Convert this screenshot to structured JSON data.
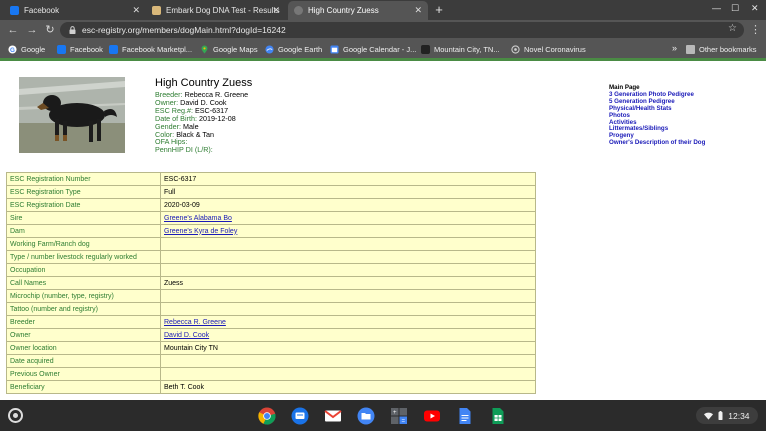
{
  "browser": {
    "tabs": [
      {
        "title": "Facebook",
        "color": "#1877f2"
      },
      {
        "title": "Embark Dog DNA Test - Results",
        "color": "#d9b87a"
      },
      {
        "title": "High Country Zuess",
        "color": "#777777"
      }
    ],
    "url": "esc-registry.org/members/dogMain.html?dogId=16242"
  },
  "bookmarks": {
    "items": [
      {
        "label": "Google",
        "icon": "google-icon",
        "color": "#ffffff"
      },
      {
        "label": "Facebook",
        "icon": "facebook-icon",
        "color": "#1877f2"
      },
      {
        "label": "Facebook Marketpl...",
        "icon": "facebook-icon",
        "color": "#1877f2"
      },
      {
        "label": "Google Maps",
        "icon": "google-maps-icon",
        "color": "#34a853"
      },
      {
        "label": "Google Earth",
        "icon": "google-earth-icon",
        "color": "#4285f4"
      },
      {
        "label": "Google Calendar - J...",
        "icon": "calendar-icon",
        "color": "#4285f4"
      },
      {
        "label": "Mountain City, TN...",
        "icon": "site-icon",
        "color": "#222222"
      },
      {
        "label": "Novel Coronavirus",
        "icon": "site-icon",
        "color": "#cccccc"
      }
    ],
    "other": "Other bookmarks"
  },
  "dog": {
    "name": "High Country Zuess",
    "fields": [
      {
        "label": "Breeder:",
        "value": "Rebecca R. Greene"
      },
      {
        "label": "Owner:",
        "value": "David D. Cook"
      },
      {
        "label": "ESC Reg.#:",
        "value": "ESC-6317"
      },
      {
        "label": "Date of Birth:",
        "value": "2019-12-08"
      },
      {
        "label": "Gender:",
        "value": "Male"
      },
      {
        "label": "Color:",
        "value": "Black & Tan"
      },
      {
        "label": "OFA Hips:",
        "value": ""
      },
      {
        "label": "PennHIP DI (L/R):",
        "value": ""
      }
    ]
  },
  "sidenav": {
    "heading": "Main Page",
    "links": [
      "3 Generation Photo Pedigree",
      "5 Generation Pedigree",
      "Physical/Health Stats",
      "Photos",
      "Activities",
      "Littermates/Siblings",
      "Progeny",
      "Owner's Description of their Dog"
    ]
  },
  "details": {
    "rows": [
      {
        "label": "ESC Registration Number",
        "value": "ESC-6317"
      },
      {
        "label": "ESC Registration Type",
        "value": "Full"
      },
      {
        "label": "ESC Registration Date",
        "value": "2020-03-09"
      },
      {
        "label": "Sire",
        "value": "Greene's Alabama Bo",
        "link": true
      },
      {
        "label": "Dam",
        "value": "Greene's Kyra de Foley",
        "link": true
      },
      {
        "label": "Working Farm/Ranch dog",
        "value": ""
      },
      {
        "label": "Type / number livestock regularly worked",
        "value": ""
      },
      {
        "label": "Occupation",
        "value": ""
      },
      {
        "label": "Call Names",
        "value": "Zuess"
      },
      {
        "label": "Microchip (number, type, registry)",
        "value": ""
      },
      {
        "label": "Tattoo (number and registry)",
        "value": ""
      },
      {
        "label": "Breeder",
        "value": "Rebecca R. Greene",
        "link": true
      },
      {
        "label": "Owner",
        "value": "David D. Cook",
        "link": true
      },
      {
        "label": "Owner location",
        "value": "Mountain City TN"
      },
      {
        "label": "Date acquired",
        "value": ""
      },
      {
        "label": "Previous Owner",
        "value": ""
      },
      {
        "label": "Beneficiary",
        "value": "Beth T. Cook"
      }
    ]
  },
  "shelf": {
    "apps": [
      {
        "icon": "chrome-icon"
      },
      {
        "icon": "messages-icon",
        "color": "#1a73e8"
      },
      {
        "icon": "gmail-icon",
        "color": "#ea4335"
      },
      {
        "icon": "files-icon",
        "color": "#4285f4"
      },
      {
        "icon": "calculator-icon",
        "color": "#5f6368"
      },
      {
        "icon": "youtube-icon",
        "color": "#ff0000"
      },
      {
        "icon": "docs-icon",
        "color": "#4285f4"
      },
      {
        "icon": "sheets-icon",
        "color": "#0f9d58"
      }
    ],
    "time": "12:34"
  }
}
